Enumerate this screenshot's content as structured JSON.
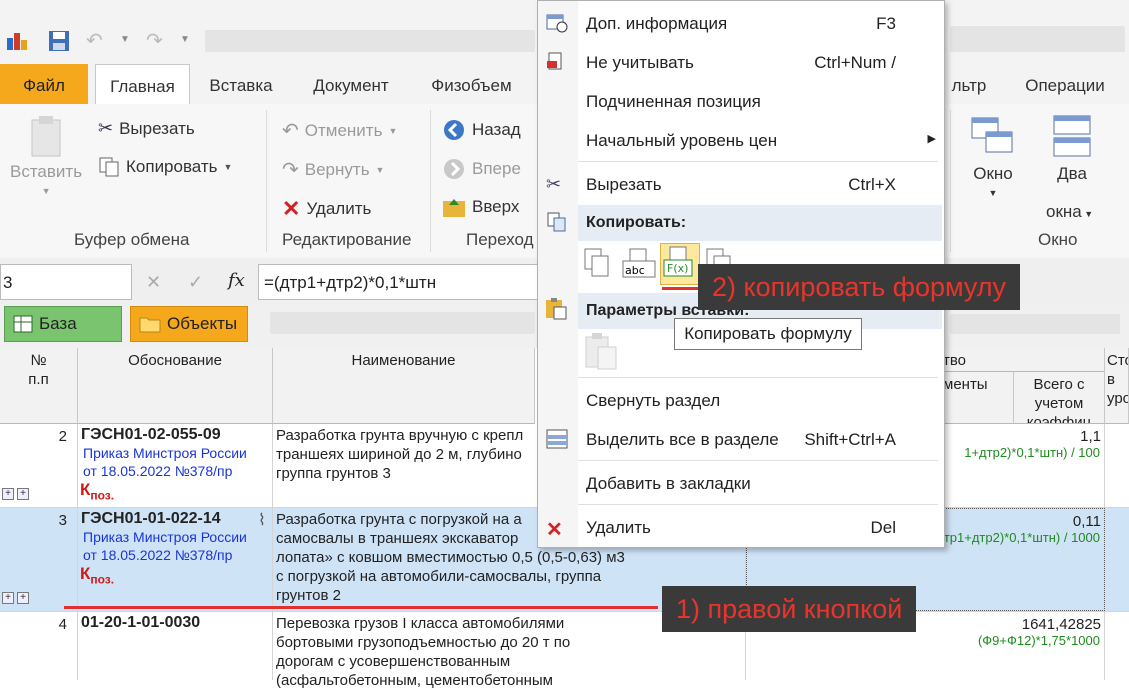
{
  "ribbon_tabs": {
    "file": "Файл",
    "home": "Главная",
    "insert": "Вставка",
    "document": "Документ",
    "physvolume": "Физобъем",
    "filter": "льтр",
    "operations": "Операции"
  },
  "clipboard": {
    "paste": "Вставить",
    "cut": "Вырезать",
    "copy": "Копировать",
    "group": "Буфер обмена"
  },
  "editing": {
    "undo": "Отменить",
    "redo": "Вернуть",
    "delete": "Удалить",
    "group": "Редактирование"
  },
  "navigation": {
    "back": "Назад",
    "forward": "Впере",
    "up": "Вверх",
    "group": "Переход"
  },
  "window": {
    "window": "Окно",
    "two": "Два",
    "two2": "окна",
    "group": "Окно"
  },
  "formula_bar": {
    "cell_ref": "3",
    "fx": "fx",
    "formula": "=(дтр1+дтр2)*0,1*штн"
  },
  "tags": {
    "base": "База",
    "objects": "Объекты"
  },
  "headers": {
    "num": "№",
    "num2": "п.п",
    "basis": "Обоснование",
    "name": "Наименование",
    "qty": "тво",
    "coef": "менты",
    "total": "Всего с",
    "total2": "учетом",
    "total3": "коэффиц",
    "cost": "Сто",
    "cost2": "в",
    "cost3": "уро"
  },
  "rows": [
    {
      "num": "2",
      "code": "ГЭСН01-02-055-09",
      "ref1": "Приказ Минстроя России",
      "ref2": "от 18.05.2022 №378/пр",
      "k": "К",
      "kp": "поз.",
      "name": [
        "Разработка грунта вручную с крепл",
        "траншеях шириной до 2 м, глубино",
        "группа грунтов 3"
      ],
      "value": "1,1",
      "formula": "1+дтр2)*0,1*штн) / 100"
    },
    {
      "num": "3",
      "code": "ГЭСН01-01-022-14",
      "ref1": "Приказ Минстроя России",
      "ref2": "от 18.05.2022 №378/пр",
      "k": "К",
      "kp": "поз.",
      "name": [
        "Разработка грунта с погрузкой на а",
        "самосвалы в траншеях экскаватор",
        "лопата» с ковшом вместимостью 0,5 (0,5-0,63) м3",
        "с погрузкой на автомобили-самосвалы, группа",
        "грунтов 2"
      ],
      "value": "0,11",
      "formula": "(дтр1+дтр2)*0,1*штн) / 1000"
    },
    {
      "num": "4",
      "code": "01-20-1-01-0030",
      "name": [
        "Перевозка грузов I класса автомобилями",
        "бортовыми грузоподъемностью до 20 т по",
        "дорогам с усовершенствованным",
        "(асфальтобетонным, цементобетонным"
      ],
      "value": "1641,42825",
      "formula": "(Ф9+Ф12)*1,75*1000"
    }
  ],
  "menu": {
    "info": "Доп. информация",
    "info_sc": "F3",
    "ignore": "Не учитывать",
    "ignore_sc": "Ctrl+Num /",
    "subpos": "Подчиненная позиция",
    "pricelevel": "Начальный уровень цен",
    "cut": "Вырезать",
    "cut_sc": "Ctrl+X",
    "copy_section": "Копировать:",
    "paste_section": "Параметры вставки:",
    "collapse": "Свернуть раздел",
    "selectall": "Выделить все в разделе",
    "selectall_sc": "Shift+Ctrl+A",
    "bookmark": "Добавить в закладки",
    "delete": "Удалить",
    "delete_sc": "Del"
  },
  "tooltip": "Копировать формулу",
  "callouts": {
    "step1": "1) правой кнопкой",
    "step2": "2) копировать формулу"
  },
  "colors": {
    "file_tab": "#f5a81c",
    "selected_row": "#cfe3f7",
    "callout_text": "#e8352b",
    "link_blue": "#1a35d6",
    "formula_green": "#1f8a1f"
  }
}
